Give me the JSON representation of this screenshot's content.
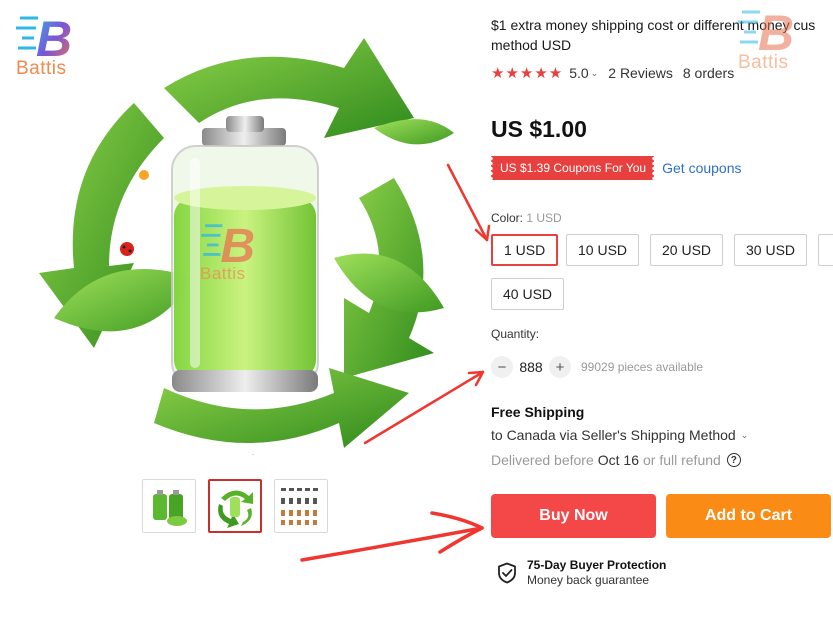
{
  "brand": {
    "logo_letter": "B",
    "logo_text": "Battis"
  },
  "product": {
    "title_line1": "$1 extra money shipping cost or different money cus",
    "title_line2": "method USD",
    "rating": "5.0",
    "reviews": "2 Reviews",
    "orders": "8 orders",
    "price": "US $1.00",
    "coupon_text": "US $1.39 Coupons For You",
    "get_coupons": "Get coupons"
  },
  "color": {
    "label": "Color:",
    "selected": "1 USD",
    "options": [
      "1 USD",
      "10 USD",
      "20 USD",
      "30 USD",
      "40 USD"
    ]
  },
  "quantity": {
    "label": "Quantity:",
    "minus": "−",
    "plus": "+",
    "value": "888",
    "available": "99029 pieces available"
  },
  "shipping": {
    "title": "Free Shipping",
    "destination": "to Canada via Seller's Shipping Method",
    "delivery_prefix": "Delivered before",
    "delivery_date": "Oct 16",
    "delivery_suffix": "or full refund",
    "help_glyph": "?"
  },
  "actions": {
    "buy_now": "Buy Now",
    "add_to_cart": "Add to Cart"
  },
  "protection": {
    "title": "75-Day Buyer Protection",
    "subtitle": "Money back guarantee"
  },
  "colors": {
    "accent_red": "#e8403f",
    "buy_now": "#f44747",
    "add_to_cart": "#fa8c15",
    "link": "#2d70c9"
  },
  "icons": [
    "star-icon",
    "chevron-down-icon",
    "minus-icon",
    "plus-icon",
    "help-icon",
    "shield-check-icon",
    "recycle-icon",
    "battery-icon"
  ]
}
